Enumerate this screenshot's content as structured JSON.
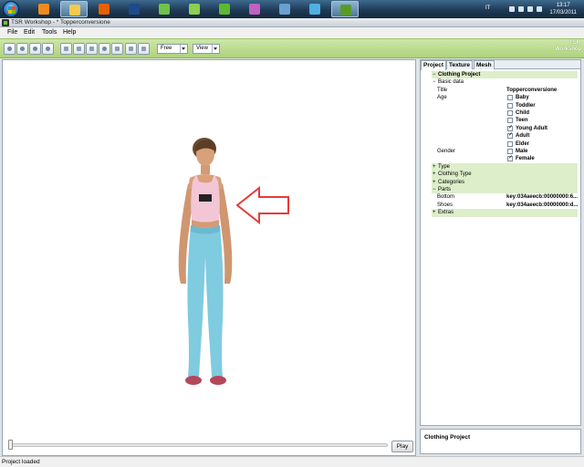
{
  "taskbar": {
    "apps": [
      {
        "icon": "media-player-icon",
        "color": "#f08a1d"
      },
      {
        "icon": "explorer-folder-icon",
        "color": "#f2c94c"
      },
      {
        "icon": "firefox-icon",
        "color": "#e66000"
      },
      {
        "icon": "photoshop-icon",
        "color": "#1d4a8c"
      },
      {
        "icon": "sims-icon",
        "color": "#6fc14a"
      },
      {
        "icon": "sims-icon",
        "color": "#8ccf52"
      },
      {
        "icon": "sims-icon",
        "color": "#5db833"
      },
      {
        "icon": "sims-icon",
        "color": "#c060c0"
      },
      {
        "icon": "tool-icon",
        "color": "#6aa0d0"
      },
      {
        "icon": "network-icon",
        "color": "#4fb0e0"
      },
      {
        "icon": "tsr-workshop-icon",
        "color": "#5a9a2a"
      }
    ],
    "lang": "IT",
    "time": "13:17",
    "date": "17/03/2011"
  },
  "window": {
    "title": "TSR Workshop - * Topperconversione"
  },
  "menu": [
    "File",
    "Edit",
    "Tools",
    "Help"
  ],
  "toolbar": {
    "camera_mode": "Free",
    "view_label": "View",
    "logo_line1": "TSR",
    "logo_line2": "Workshop"
  },
  "viewport": {
    "play_label": "Play",
    "timeline_position": 0
  },
  "panel": {
    "tabs": [
      "Project",
      "Texture",
      "Mesh"
    ],
    "active_tab": "Project",
    "root": "Clothing Project",
    "basic_data": "Basic data",
    "title_label": "Title",
    "title_value": "Topperconversione",
    "age_label": "Age",
    "ages": [
      {
        "label": "Baby",
        "checked": false
      },
      {
        "label": "Toddler",
        "checked": false
      },
      {
        "label": "Child",
        "checked": false
      },
      {
        "label": "Teen",
        "checked": false
      },
      {
        "label": "Young Adult",
        "checked": true
      },
      {
        "label": "Adult",
        "checked": true
      },
      {
        "label": "Elder",
        "checked": false
      }
    ],
    "gender_label": "Gender",
    "genders": [
      {
        "label": "Male",
        "checked": false
      },
      {
        "label": "Female",
        "checked": true
      }
    ],
    "sections": [
      "Type",
      "Clothing Type",
      "Categories"
    ],
    "parts_label": "Parts",
    "parts": [
      {
        "label": "Bottom",
        "value": "key:034aeecb:00000000:6..."
      },
      {
        "label": "Shoes",
        "value": "key:034aeecb:00000000:d..."
      }
    ],
    "extras_label": "Extras",
    "description": "Clothing Project"
  },
  "status": "Project loaded",
  "colors": {
    "toolbar_green": "#b5d987",
    "accent_arrow": "#e53b3b",
    "top_pink": "#f3c6d6",
    "pants_blue": "#7fcbe0"
  }
}
